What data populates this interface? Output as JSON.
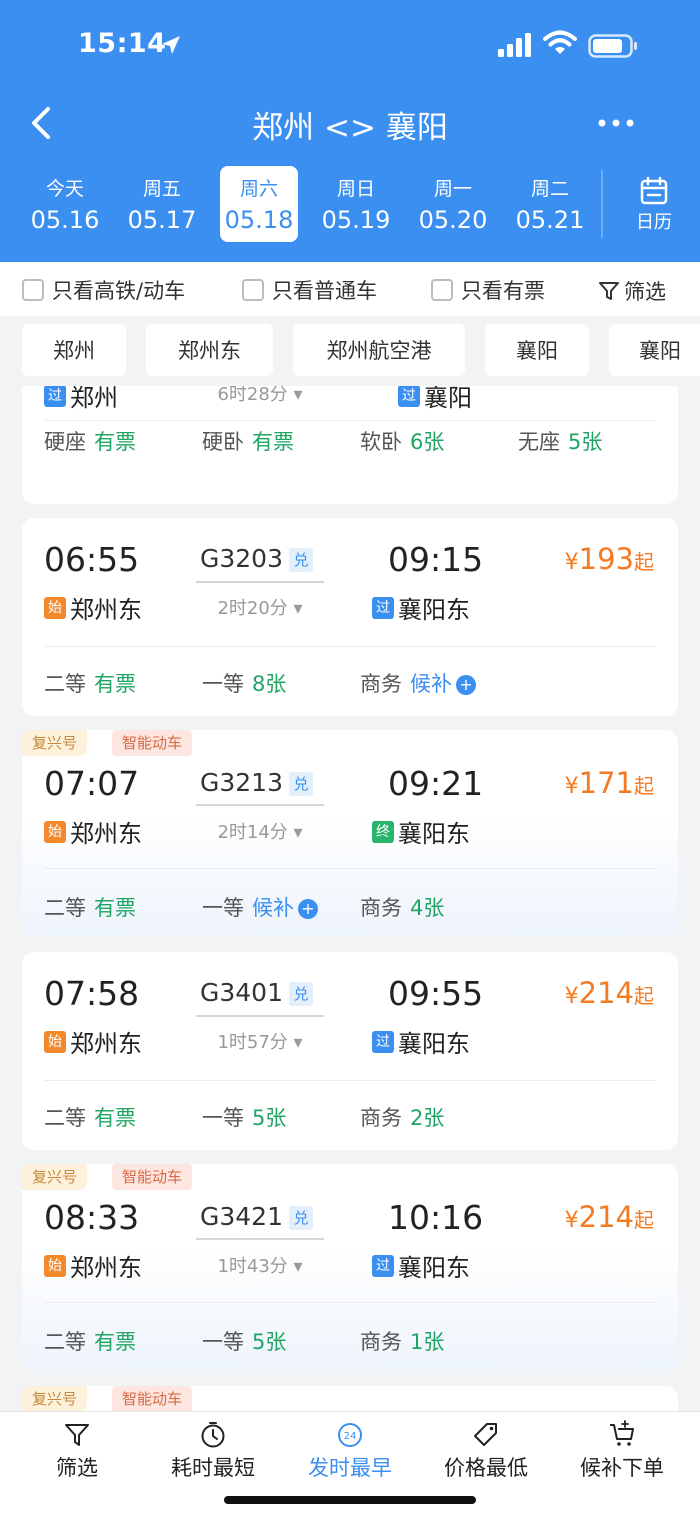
{
  "status_bar": {
    "time": "15:14"
  },
  "nav": {
    "title": "郑州 <> 襄阳"
  },
  "dates": [
    {
      "weekday": "今天",
      "date": "05.16"
    },
    {
      "weekday": "周五",
      "date": "05.17"
    },
    {
      "weekday": "周六",
      "date": "05.18",
      "active": true
    },
    {
      "weekday": "周日",
      "date": "05.19"
    },
    {
      "weekday": "周一",
      "date": "05.20"
    },
    {
      "weekday": "周二",
      "date": "05.21"
    }
  ],
  "calendar_label": "日历",
  "filters": {
    "gaotie": "只看高铁/动车",
    "putong": "只看普通车",
    "youpiao": "只看有票",
    "shaixuan": "筛选"
  },
  "stations": [
    "郑州",
    "郑州东",
    "郑州航空港",
    "襄阳",
    "襄阳"
  ],
  "partial_card": {
    "from": "郑州",
    "duration": "6时28分",
    "to": "襄阳",
    "seats": [
      {
        "name": "硬座",
        "value": "有票"
      },
      {
        "name": "硬卧",
        "value": "有票"
      },
      {
        "name": "软卧",
        "value": "6张"
      },
      {
        "name": "无座",
        "value": "5张"
      }
    ]
  },
  "trains": [
    {
      "dep": "06:55",
      "arr": "09:15",
      "no": "G3203",
      "dui": "兑",
      "duration": "2时20分",
      "from": "郑州东",
      "from_badge": "始",
      "to": "襄阳东",
      "to_badge": "过",
      "price": "193",
      "yen": "¥",
      "qi": "起",
      "tags": [],
      "seats": [
        {
          "name": "二等",
          "value": "有票"
        },
        {
          "name": "一等",
          "value": "8张"
        },
        {
          "name": "商务",
          "value": "候补",
          "plus": true
        }
      ]
    },
    {
      "dep": "07:07",
      "arr": "09:21",
      "no": "G3213",
      "dui": "兑",
      "duration": "2时14分",
      "from": "郑州东",
      "from_badge": "始",
      "to": "襄阳东",
      "to_badge": "终",
      "price": "171",
      "yen": "¥",
      "qi": "起",
      "tags": [
        "复兴号",
        "智能动车"
      ],
      "seats": [
        {
          "name": "二等",
          "value": "有票"
        },
        {
          "name": "一等",
          "value": "候补",
          "plus": true
        },
        {
          "name": "商务",
          "value": "4张"
        }
      ]
    },
    {
      "dep": "07:58",
      "arr": "09:55",
      "no": "G3401",
      "dui": "兑",
      "duration": "1时57分",
      "from": "郑州东",
      "from_badge": "始",
      "to": "襄阳东",
      "to_badge": "过",
      "price": "214",
      "yen": "¥",
      "qi": "起",
      "tags": [],
      "seats": [
        {
          "name": "二等",
          "value": "有票"
        },
        {
          "name": "一等",
          "value": "5张"
        },
        {
          "name": "商务",
          "value": "2张"
        }
      ]
    },
    {
      "dep": "08:33",
      "arr": "10:16",
      "no": "G3421",
      "dui": "兑",
      "duration": "1时43分",
      "from": "郑州东",
      "from_badge": "始",
      "to": "襄阳东",
      "to_badge": "过",
      "price": "214",
      "yen": "¥",
      "qi": "起",
      "tags": [
        "复兴号",
        "智能动车"
      ],
      "seats": [
        {
          "name": "二等",
          "value": "有票"
        },
        {
          "name": "一等",
          "value": "5张"
        },
        {
          "name": "商务",
          "value": "1张"
        }
      ]
    }
  ],
  "next_card_tags": [
    "复兴号",
    "智能动车"
  ],
  "tabbar": [
    {
      "label": "筛选",
      "icon": "filter-icon"
    },
    {
      "label": "耗时最短",
      "icon": "timer-icon"
    },
    {
      "label": "发时最早",
      "icon": "clock-24-icon",
      "active": true,
      "icon_text": "24"
    },
    {
      "label": "价格最低",
      "icon": "price-tag-icon"
    },
    {
      "label": "候补下单",
      "icon": "cart-plus-icon"
    }
  ],
  "colors": {
    "brand_blue": "#3a8ff1",
    "price_orange": "#f47b23",
    "available_green": "#1fa463"
  }
}
